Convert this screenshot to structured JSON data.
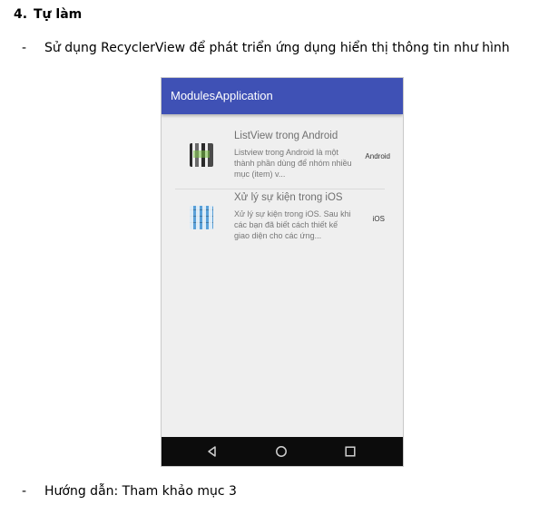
{
  "doc": {
    "heading_number": "4.",
    "heading_text": "Tự làm",
    "bullet_dash": "-",
    "bullet1": "Sử dụng RecyclerView để phát triển ứng dụng hiển thị thông tin như hình",
    "bullet2": "Hướng dẫn: Tham khảo mục 3"
  },
  "phone": {
    "app_title": "ModulesApplication",
    "accent_color": "#3f51b5",
    "items": [
      {
        "icon": "android-apps-icon",
        "title": "ListView trong Android",
        "description": "Listview trong Android là một thành phần dùng để nhóm nhiều mục (item) v...",
        "tag": "Android"
      },
      {
        "icon": "ios-apps-icon",
        "title": "Xử lý sự kiện trong iOS",
        "description": "Xử lý sự kiện trong iOS. Sau khi các bạn đã biết cách thiết kế giao diện cho các ứng...",
        "tag": "iOS"
      }
    ],
    "nav": [
      "back-icon",
      "home-icon",
      "recent-apps-icon"
    ]
  }
}
